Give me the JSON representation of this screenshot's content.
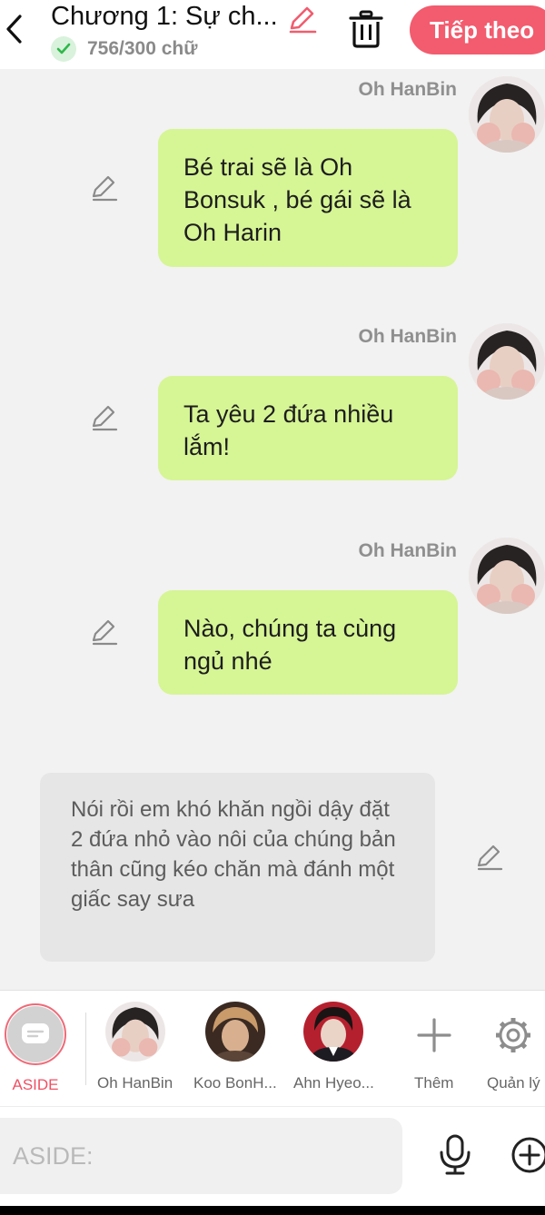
{
  "header": {
    "title": "Chương 1: Sự ch...",
    "word_count": "756/300 chữ",
    "next_label": "Tiếp theo"
  },
  "messages": [
    {
      "sender": "Oh HanBin",
      "text": "Bé trai sẽ là Oh Bonsuk , bé gái sẽ là Oh Harin"
    },
    {
      "sender": "Oh HanBin",
      "text": "Ta yêu 2 đứa nhiều lắm!"
    },
    {
      "sender": "Oh HanBin",
      "text": "Nào, chúng ta cùng ngủ nhé"
    }
  ],
  "aside": {
    "text": "Nói rồi em khó khăn ngồi dậy đặt 2 đứa nhỏ vào nôi của chúng bản thân cũng kéo chăn mà đánh một giấc say sưa"
  },
  "characters": [
    {
      "label": "ASIDE"
    },
    {
      "label": "Oh HanBin"
    },
    {
      "label": "Koo BonH..."
    },
    {
      "label": "Ahn Hyeo..."
    },
    {
      "label": "Thêm"
    },
    {
      "label": "Quản lý"
    }
  ],
  "input": {
    "placeholder": "ASIDE:"
  },
  "colors": {
    "accent": "#f25c6e",
    "bubble": "#d6f595",
    "aside_bg": "#e6e6e6",
    "check_green": "#2eb84a"
  },
  "icons": [
    "back-icon",
    "pencil-icon",
    "check-icon",
    "trash-icon",
    "microphone-icon",
    "plus-circle-icon",
    "plus-icon",
    "gear-icon"
  ]
}
